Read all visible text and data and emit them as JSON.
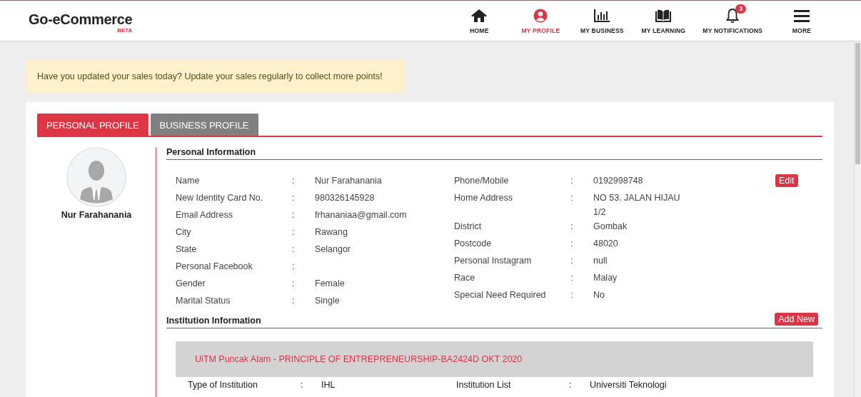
{
  "brand": {
    "name": "Go-eCommerce",
    "tag": "BETA"
  },
  "nav": [
    {
      "label": "HOME",
      "kind": "home",
      "selected": false
    },
    {
      "label": "MY PROFILE",
      "kind": "user",
      "selected": true
    },
    {
      "label": "MY BUSINESS",
      "kind": "chart",
      "selected": false
    },
    {
      "label": "MY LEARNING",
      "kind": "book",
      "selected": false
    },
    {
      "label": "MY NOTIFICATIONS",
      "kind": "bell",
      "selected": false,
      "badge": "3"
    },
    {
      "label": "MORE",
      "kind": "menu",
      "selected": false
    }
  ],
  "notice": "Have you updated your sales today? Update your sales regularly to collect more points!",
  "tabs": [
    {
      "label": "PERSONAL PROFILE",
      "selected": true
    },
    {
      "label": "BUSINESS PROFILE",
      "selected": false
    }
  ],
  "profile_name": "Nur Farahanania",
  "personal_information": {
    "title": "Personal Information",
    "edit_button": "Edit",
    "left": [
      {
        "label": "Name",
        "separator": ":",
        "value": "Nur Farahanania"
      },
      {
        "label": "New Identity Card No.",
        "separator": ":",
        "value": "980326145928"
      },
      {
        "label": "Email Address",
        "separator": ":",
        "value": "frhananiaa@gmail.com"
      },
      {
        "label": "City",
        "separator": ":",
        "value": "Rawang"
      },
      {
        "label": "State",
        "separator": ":",
        "value": "Selangor"
      },
      {
        "label": "Personal Facebook",
        "separator": ":"
      },
      {
        "label": "Gender",
        "separator": ":",
        "value": "Female"
      },
      {
        "label": "Marital Status",
        "separator": ":",
        "value": "Single"
      }
    ],
    "right": [
      {
        "label": "Phone/Mobile",
        "separator": ":",
        "value": "0192998748"
      },
      {
        "label": "Home Address",
        "separator": ":",
        "value": "NO 53. JALAN HIJAU 1/2"
      },
      {
        "label": "District",
        "separator": ":",
        "value": "Gombak"
      },
      {
        "label": "Postcode",
        "separator": ":",
        "value": "48020"
      },
      {
        "label": "Personal Instagram",
        "separator": ":",
        "value": "null"
      },
      {
        "label": "Race",
        "separator": ":",
        "value": "Malay"
      },
      {
        "label": "Special Need Required",
        "separator": ":",
        "value": "No"
      }
    ]
  },
  "institution_information": {
    "title": "Institution Information",
    "add_button": "Add New",
    "entry": {
      "title": "UiTM Puncak Alam - PRINCIPLE OF ENTREPRENEURSHIP-BA2424D OKT 2020",
      "fields": [
        {
          "label": "Type of Institution",
          "separator": ":",
          "value": "IHL"
        },
        {
          "label": "Institution List",
          "separator": ":",
          "value": "Universiti Teknologi"
        }
      ]
    }
  }
}
